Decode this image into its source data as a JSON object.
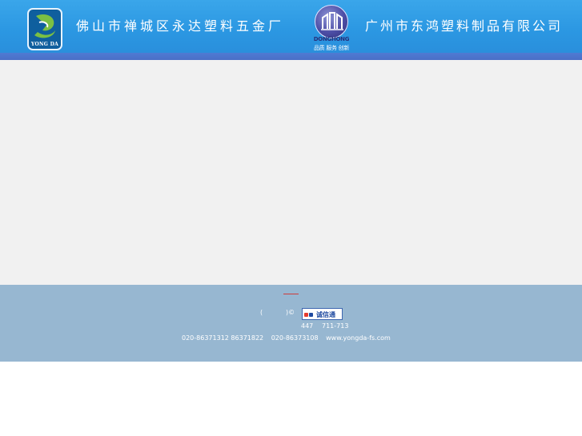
{
  "header": {
    "left_logo": {
      "wordmark": "YONG DA"
    },
    "company1": "佛山市禅城区永达塑料五金厂",
    "right_logo": {
      "brand": "DONGHONG",
      "tagline": "品质 服务 创新"
    },
    "company2": "广州市东鸿塑料制品有限公司",
    "colors": {
      "header_blue": "#2b97e2",
      "bar_blue": "#4f7bd3"
    }
  },
  "content": {
    "background": "#f1f1f1"
  },
  "footer": {
    "paren": "(",
    "copyright_mark": ")©",
    "badge_text": "诚信通",
    "reg_a": "447",
    "reg_b": "711-713",
    "phone1": "020-86371312 86371822",
    "phone2": "020-86373108",
    "website": "www.yongda-fs.com",
    "colors": {
      "footer_bg": "#97b7d1",
      "accent_rule": "#cc3b3b"
    }
  }
}
